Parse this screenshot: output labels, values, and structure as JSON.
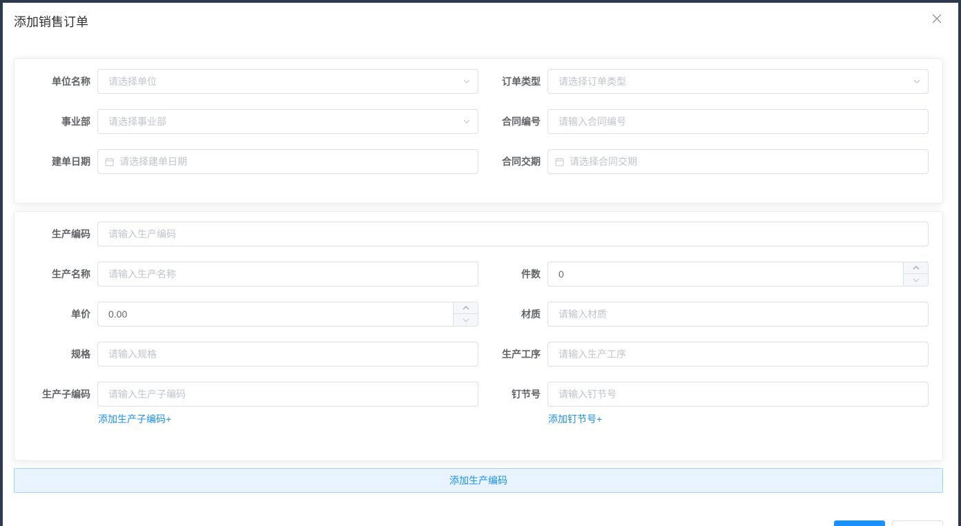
{
  "dialog": {
    "title": "添加销售订单",
    "close_icon": "close-icon"
  },
  "order": {
    "unit": {
      "label": "单位名称",
      "placeholder": "请选择单位"
    },
    "order_type": {
      "label": "订单类型",
      "placeholder": "请选择订单类型"
    },
    "division": {
      "label": "事业部",
      "placeholder": "请选择事业部"
    },
    "contract_no": {
      "label": "合同编号",
      "placeholder": "请输入合同编号"
    },
    "create_date": {
      "label": "建单日期",
      "placeholder": "请选择建单日期"
    },
    "delivery_date": {
      "label": "合同交期",
      "placeholder": "请选择合同交期"
    }
  },
  "production": {
    "code": {
      "label": "生产编码",
      "placeholder": "请输入生产编码"
    },
    "name": {
      "label": "生产名称",
      "placeholder": "请输入生产名称"
    },
    "quantity": {
      "label": "件数",
      "value": "0"
    },
    "unit_price": {
      "label": "单价",
      "value": "0.00"
    },
    "material": {
      "label": "材质",
      "placeholder": "请输入材质"
    },
    "spec": {
      "label": "规格",
      "placeholder": "请输入规格"
    },
    "process": {
      "label": "生产工序",
      "placeholder": "请输入生产工序"
    },
    "sub_code": {
      "label": "生产子编码",
      "placeholder": "请输入生产子编码",
      "add_link": "添加生产子编码+"
    },
    "nail_no": {
      "label": "钉节号",
      "placeholder": "请输入钉节号",
      "add_link": "添加钉节号+"
    }
  },
  "add_production_code": "添加生产编码",
  "colors": {
    "primary": "#1890ff",
    "border": "#dcdfe6",
    "placeholder": "#c0c4cc",
    "text": "#606266",
    "add_bar_bg": "#e8f4ff"
  }
}
